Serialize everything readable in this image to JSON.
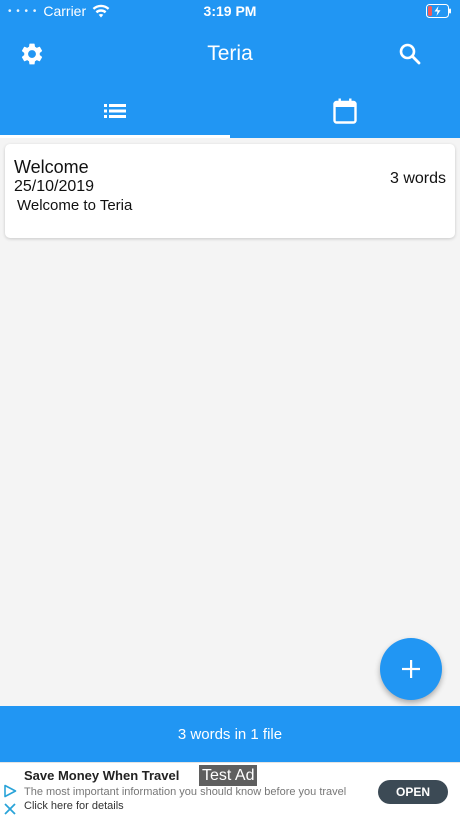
{
  "status_bar": {
    "carrier": "Carrier",
    "time": "3:19 PM",
    "signal_dots": "• • • •"
  },
  "app_bar": {
    "title": "Teria",
    "left_icon": "gear-icon",
    "right_icon": "search-icon"
  },
  "tabs": [
    {
      "icon": "list-icon",
      "selected": true
    },
    {
      "icon": "calendar-icon",
      "selected": false
    }
  ],
  "notes": [
    {
      "title": "Welcome",
      "date": "25/10/2019",
      "preview": "Welcome to Teria",
      "word_count": "3 words"
    }
  ],
  "fab": {
    "icon": "plus-icon"
  },
  "summary": {
    "text": "3 words in 1 file"
  },
  "ad": {
    "title": "Save Money When Travel",
    "tag": "Test Ad",
    "description": "The most important information you should know before you travel",
    "link": "Click here for details",
    "cta": "OPEN"
  },
  "colors": {
    "primary": "#2196f3",
    "background": "#f4f4f4",
    "ad_button": "#3c4a55",
    "battery_low": "#f05a5a"
  }
}
